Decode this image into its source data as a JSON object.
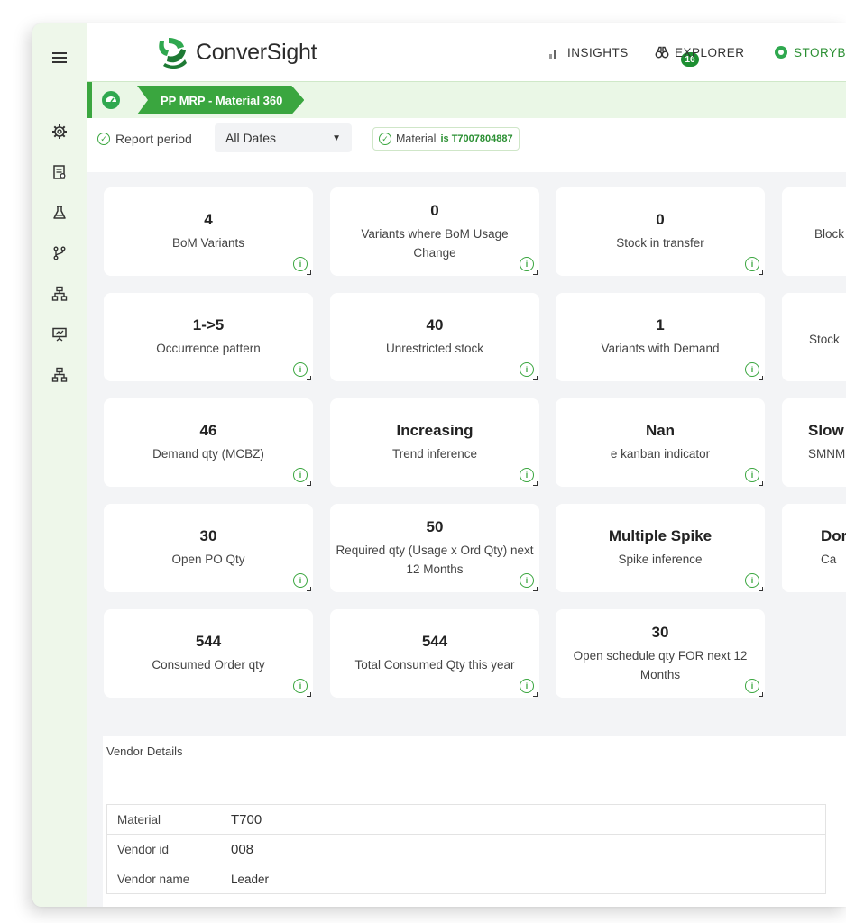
{
  "brand": {
    "name": "ConverSight",
    "color": "#3aa63f"
  },
  "nav": {
    "insights_label": "INSIGHTS",
    "insights_count": "16",
    "explorer_label": "EXPLORER",
    "storyboard_label": "STORYB"
  },
  "sidebar": {
    "icons": [
      "menu-icon",
      "gear-icon",
      "report-icon",
      "flask-icon",
      "branch-icon",
      "hierarchy-icon",
      "presentation-icon",
      "hierarchy-icon"
    ]
  },
  "breadcrumb": {
    "label": "PP MRP - Material 360"
  },
  "filters": {
    "report_period_label": "Report period",
    "period_value": "All Dates",
    "material_chip_label": "Material",
    "material_chip_value": "is T7007804887"
  },
  "kpis": {
    "row1": [
      {
        "value": "4",
        "label": "BoM Variants"
      },
      {
        "value": "0",
        "label": "Variants where BoM Usage Change"
      },
      {
        "value": "0",
        "label": "Stock in transfer"
      },
      {
        "value": "",
        "label": "Block"
      }
    ],
    "row2": [
      {
        "value": "1->5",
        "label": "Occurrence pattern"
      },
      {
        "value": "40",
        "label": "Unrestricted stock"
      },
      {
        "value": "1",
        "label": "Variants with Demand"
      },
      {
        "value": "",
        "label": "Stock"
      }
    ],
    "row3": [
      {
        "value": "46",
        "label": "Demand qty (MCBZ)"
      },
      {
        "value": "Increasing",
        "label": "Trend inference"
      },
      {
        "value": "Nan",
        "label": "e kanban indicator"
      },
      {
        "value": "Slow",
        "label": "SMNM"
      }
    ],
    "row4": [
      {
        "value": "30",
        "label": "Open PO Qty"
      },
      {
        "value": "50",
        "label": "Required qty (Usage x Ord Qty) next 12 Months"
      },
      {
        "value": "Multiple Spike",
        "label": "Spike inference"
      },
      {
        "value": "Dor",
        "label": "Ca"
      }
    ],
    "row5": [
      {
        "value": "544",
        "label": "Consumed Order qty"
      },
      {
        "value": "544",
        "label": "Total Consumed Qty this year"
      },
      {
        "value": "30",
        "label": "Open schedule qty FOR next 12 Months"
      }
    ]
  },
  "vendor": {
    "title": "Vendor Details",
    "rows": [
      {
        "key": "Material",
        "value": "T700"
      },
      {
        "key": "Vendor id",
        "value": "008"
      },
      {
        "key": "Vendor name",
        "value": "Leader"
      }
    ]
  }
}
